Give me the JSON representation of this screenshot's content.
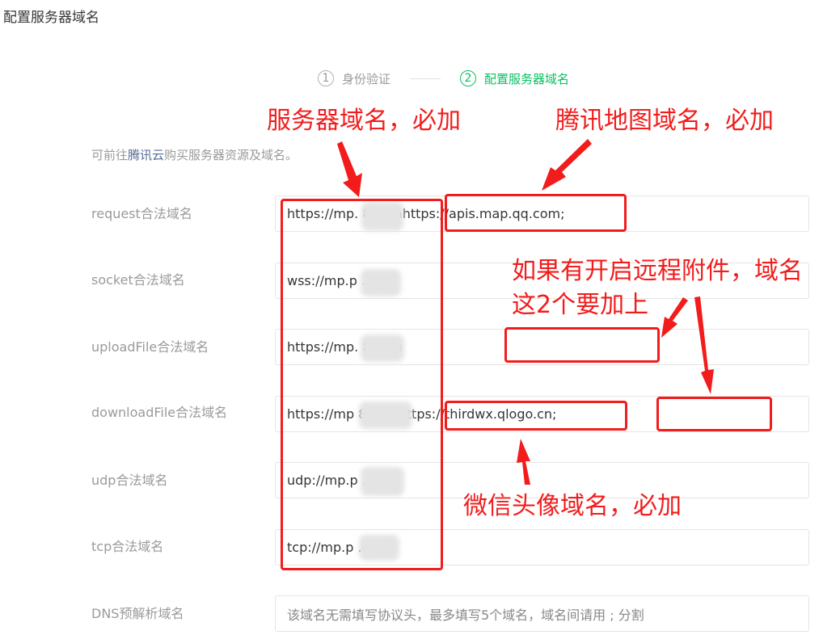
{
  "page_title": "配置服务器域名",
  "steps": [
    {
      "num": "1",
      "label": "身份验证"
    },
    {
      "num": "2",
      "label": "配置服务器域名"
    }
  ],
  "hint": {
    "prefix": "可前往",
    "link": "腾讯云",
    "suffix": "购买服务器资源及域名。"
  },
  "rows": [
    {
      "label": "request合法域名",
      "domain": "https://mp.      8.com",
      "extra": "https://apis.map.qq.com;"
    },
    {
      "label": "socket合法域名",
      "domain": "wss://mp.p        .com;"
    },
    {
      "label": "uploadFile合法域名",
      "domain": "https://mp.        8.com"
    },
    {
      "label": "downloadFile合法域名",
      "domain": "https://mp         8.com",
      "extra": "https://thirdwx.qlogo.cn;"
    },
    {
      "label": "udp合法域名",
      "domain": "udp://mp.p        .com;"
    },
    {
      "label": "tcp合法域名",
      "domain": "tcp://mp.p          .com;"
    },
    {
      "label": "DNS预解析域名",
      "placeholder": "该域名无需填写协议头，最多填写5个域名，域名间请用 ; 分割"
    }
  ],
  "annotations": {
    "server": "服务器域名，必加",
    "map": "腾讯地图域名，必加",
    "remote_line1": "如果有开启远程附件，域名",
    "remote_line2": "这2个要加上",
    "avatar": "微信头像域名，必加"
  },
  "colors": {
    "accent": "#07c160",
    "annotation": "#f21c1c",
    "link": "#576b95"
  }
}
